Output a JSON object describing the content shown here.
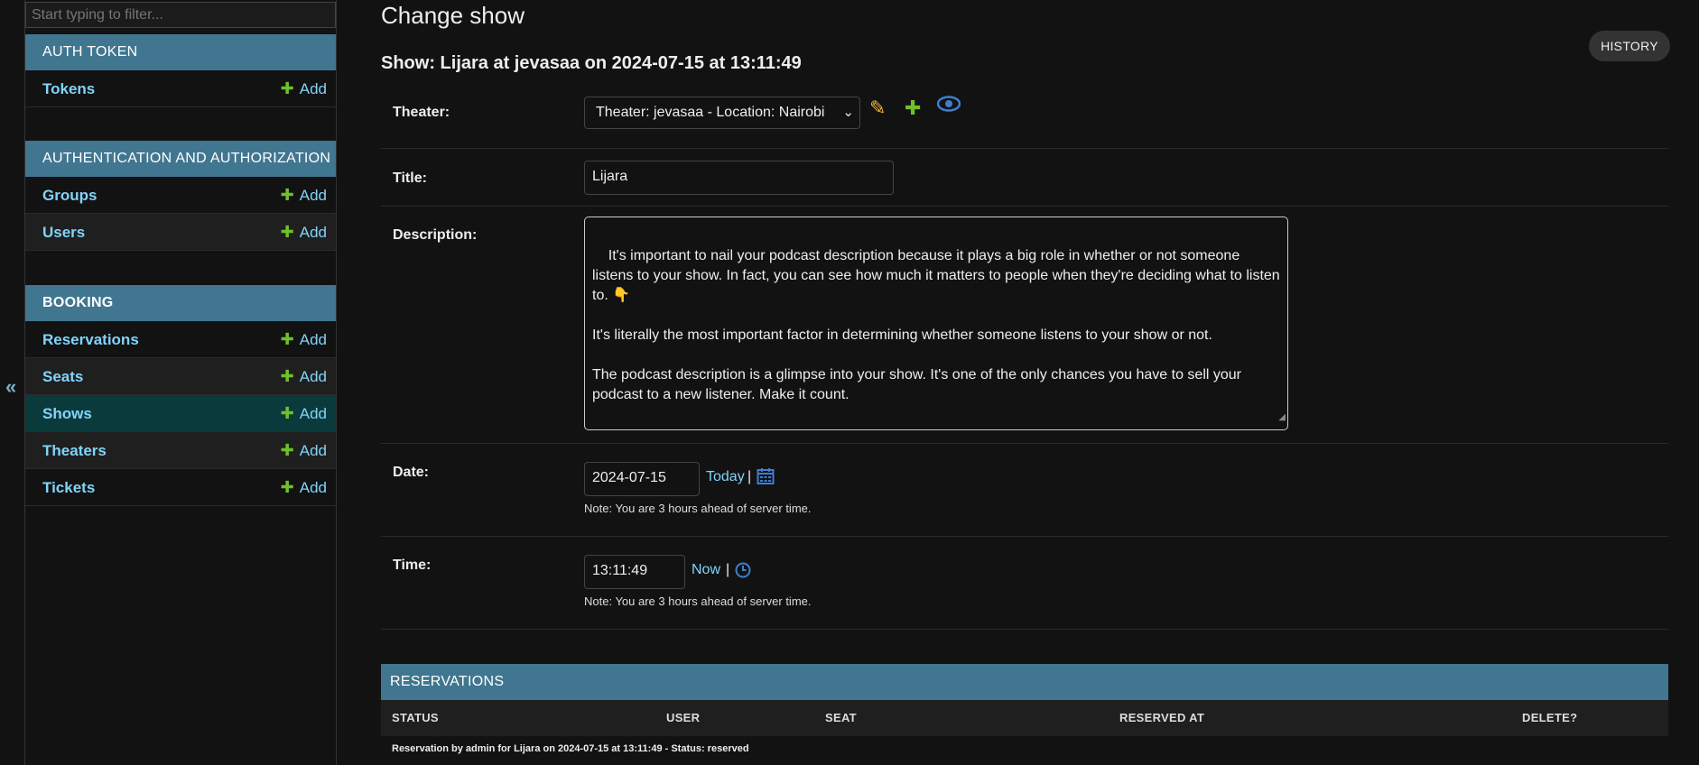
{
  "sidebar": {
    "filter_placeholder": "Start typing to filter...",
    "collapse_glyph": "«",
    "modules": [
      {
        "title": "AUTH TOKEN",
        "items": [
          {
            "label": "Tokens",
            "add": "Add"
          }
        ]
      },
      {
        "title": "AUTHENTICATION AND AUTHORIZATION",
        "items": [
          {
            "label": "Groups",
            "add": "Add"
          },
          {
            "label": "Users",
            "add": "Add"
          }
        ]
      },
      {
        "title": "BOOKING",
        "items": [
          {
            "label": "Reservations",
            "add": "Add"
          },
          {
            "label": "Seats",
            "add": "Add"
          },
          {
            "label": "Shows",
            "add": "Add"
          },
          {
            "label": "Theaters",
            "add": "Add"
          },
          {
            "label": "Tickets",
            "add": "Add"
          }
        ]
      }
    ]
  },
  "header": {
    "title": "Change show",
    "subtitle": "Show: Lijara at jevasaa on 2024-07-15 at 13:11:49",
    "history": "HISTORY"
  },
  "form": {
    "theater": {
      "label": "Theater:",
      "value": "Theater: jevasaa - Location: Nairobi",
      "icons": [
        "pencil-icon",
        "plus-icon",
        "eye-icon"
      ]
    },
    "title": {
      "label": "Title:",
      "value": "Lijara"
    },
    "description": {
      "label": "Description:",
      "value": "It's important to nail your podcast description because it plays a big role in whether or not someone listens to your show. In fact, you can see how much it matters to people when they're deciding what to listen to. 👇\n\nIt's literally the most important factor in determining whether someone listens to your show or not.\n\nThe podcast description is a glimpse into your show. It's one of the only chances you have to sell your podcast to a new listener. Make it count."
    },
    "date": {
      "label": "Date:",
      "value": "2024-07-15",
      "shortcut": "Today",
      "separator": "|",
      "note": "Note: You are 3 hours ahead of server time."
    },
    "time": {
      "label": "Time:",
      "value": "13:11:49",
      "shortcut": "Now",
      "separator": "|",
      "note": "Note: You are 3 hours ahead of server time."
    }
  },
  "inline": {
    "title": "RESERVATIONS",
    "columns": [
      "STATUS",
      "USER",
      "SEAT",
      "RESERVED AT",
      "DELETE?"
    ],
    "row_text": "Reservation by admin for Lijara on 2024-07-15 at 13:11:49 - Status: reserved"
  },
  "colors": {
    "accent": "#417690",
    "link": "#81d4fa",
    "add_plus": "#70bf2b",
    "pencil": "#f5b72e",
    "eye": "#3d7fd1"
  }
}
